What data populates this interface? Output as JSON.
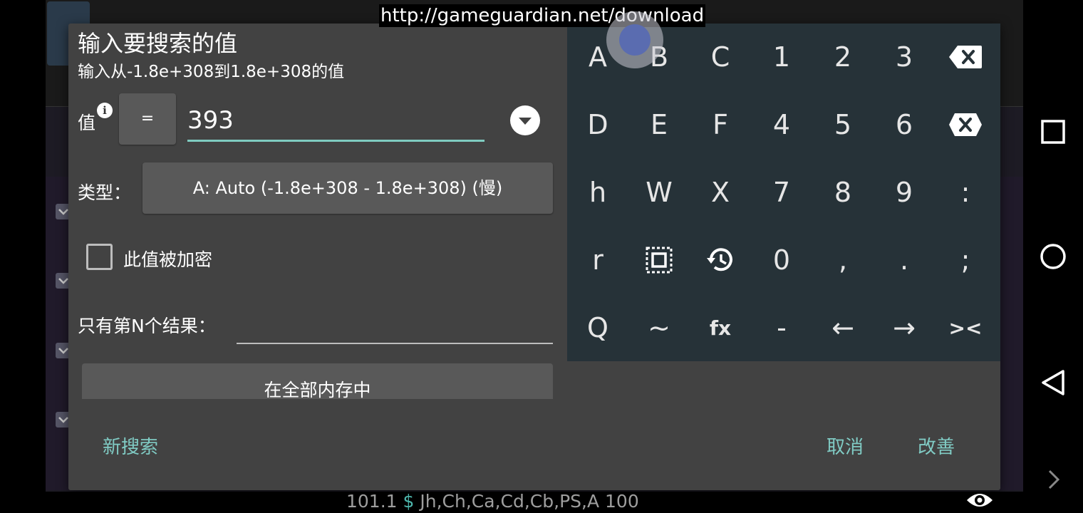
{
  "url_banner": "http://gameguardian.net/download",
  "dialog": {
    "title": "输入要搜索的值",
    "subtitle": "输入从-1.8e+308到1.8e+308的值",
    "value_label": "值",
    "info_icon": "i",
    "operator": "=",
    "value": "393",
    "type_label": "类型：",
    "type_value": "A: Auto (-1.8e+308 - 1.8e+308) (慢)",
    "encrypted_label": "此值被加密",
    "encrypted_checked": false,
    "nth_label": "只有第N个结果：",
    "nth_value": "",
    "memory_button": "在全部内存中",
    "new_search": "新搜索",
    "cancel": "取消",
    "refine": "改善"
  },
  "keyboard": {
    "rows": [
      [
        "A",
        "B",
        "C",
        "1",
        "2",
        "3",
        "backspace-icon"
      ],
      [
        "D",
        "E",
        "F",
        "4",
        "5",
        "6",
        "clear-icon"
      ],
      [
        "h",
        "W",
        "X",
        "7",
        "8",
        "9",
        ":"
      ],
      [
        "r",
        "select-all-icon",
        "history-icon",
        "0",
        ",",
        ".",
        ";"
      ],
      [
        "Q",
        "~",
        "fx",
        "-",
        "←",
        "→",
        "><"
      ]
    ]
  },
  "status_line": {
    "before": "101.1 ",
    "dollar": "$",
    "after": " Jh,Ch,Ca,Cd,Cb,PS,A 100"
  },
  "colors": {
    "accent": "#80cbc4",
    "dialog_bg": "#424242",
    "keyboard_bg": "#263238",
    "button_bg": "#595959"
  }
}
